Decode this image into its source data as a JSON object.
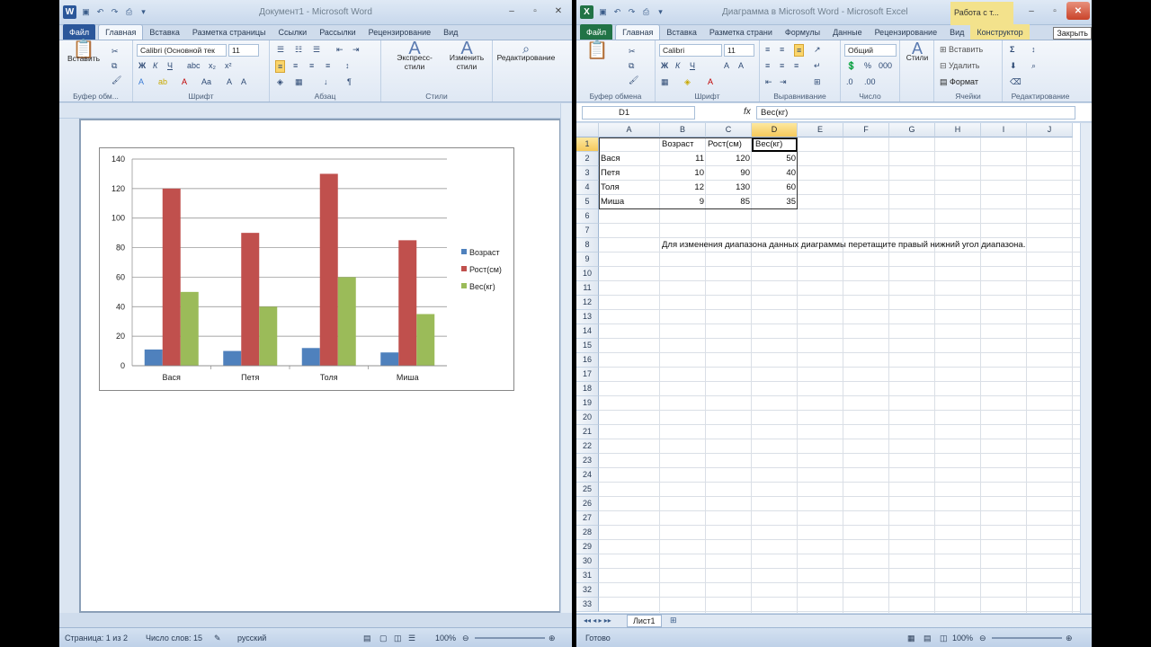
{
  "word": {
    "title": "Документ1 - Microsoft Word",
    "tabs": [
      "Файл",
      "Главная",
      "Вставка",
      "Разметка страницы",
      "Ссылки",
      "Рассылки",
      "Рецензирование",
      "Вид"
    ],
    "groups": {
      "clipboard": "Буфер обм...",
      "font": "Шрифт",
      "paragraph": "Абзац",
      "styles": "Стили"
    },
    "paste_label": "Вставить",
    "font_name": "Calibri (Основной тек",
    "font_size": "11",
    "express_styles": "Экспресс-стили",
    "change_styles": "Изменить стили",
    "editing": "Редактирование",
    "status": {
      "page": "Страница: 1 из 2",
      "words": "Число слов: 15",
      "lang": "русский",
      "zoom": "100%"
    }
  },
  "excel": {
    "title": "Диаграмма в Microsoft Word - Microsoft Excel",
    "context_tab": "Работа с т...",
    "tabs": [
      "Файл",
      "Главная",
      "Вставка",
      "Разметка страни",
      "Формулы",
      "Данные",
      "Рецензирование",
      "Вид",
      "Конструктор"
    ],
    "groups": {
      "clipboard": "Буфер обмена",
      "font": "Шрифт",
      "alignment": "Выравнивание",
      "number": "Число",
      "cells": "Ячейки",
      "editing": "Редактирование"
    },
    "font_name": "Calibri",
    "font_size": "11",
    "number_format": "Общий",
    "styles": "Стили",
    "insert": "Вставить",
    "delete": "Удалить",
    "format": "Формат",
    "name_box": "D1",
    "fx": "fx",
    "formula": "Вес(кг)",
    "columns": [
      "A",
      "B",
      "C",
      "D",
      "E",
      "F",
      "G",
      "H",
      "I",
      "J"
    ],
    "rows": [
      "1",
      "2",
      "3",
      "4",
      "5",
      "6",
      "7",
      "8",
      "9",
      "10",
      "11",
      "12",
      "13",
      "14",
      "15",
      "16",
      "17",
      "18",
      "19",
      "20",
      "21",
      "22",
      "23",
      "24",
      "25",
      "26",
      "27",
      "28",
      "29",
      "30",
      "31",
      "32",
      "33"
    ],
    "cells": {
      "B1": "Возраст",
      "C1": "Рост(см)",
      "D1": "Вес(кг)",
      "A2": "Вася",
      "B2": "11",
      "C2": "120",
      "D2": "50",
      "A3": "Петя",
      "B3": "10",
      "C3": "90",
      "D3": "40",
      "A4": "Толя",
      "B4": "12",
      "C4": "130",
      "D4": "60",
      "A5": "Миша",
      "B5": "9",
      "C5": "85",
      "D5": "35"
    },
    "note": "Для изменения диапазона данных диаграммы перетащите правый нижний угол диапазона.",
    "sheet_tab": "Лист1",
    "status": "Готово",
    "zoom": "100%",
    "tooltip": "Закрыть"
  },
  "colors": {
    "word_blue": "#2b579a",
    "excel_green": "#217346",
    "vozrast": "#4f81bd",
    "rost": "#c0504d",
    "ves": "#9bbb59",
    "context": "#f3e28c"
  },
  "chart_data": {
    "type": "bar",
    "categories": [
      "Вася",
      "Петя",
      "Толя",
      "Миша"
    ],
    "series": [
      {
        "name": "Возраст",
        "values": [
          11,
          10,
          12,
          9
        ],
        "color": "#4f81bd"
      },
      {
        "name": "Рост(см)",
        "values": [
          120,
          90,
          130,
          85
        ],
        "color": "#c0504d"
      },
      {
        "name": "Вес(кг)",
        "values": [
          50,
          40,
          60,
          35
        ],
        "color": "#9bbb59"
      }
    ],
    "yticks": [
      "0",
      "20",
      "40",
      "60",
      "80",
      "100",
      "120",
      "140"
    ],
    "ylim": [
      0,
      140
    ],
    "grid": true,
    "legend": "right"
  }
}
